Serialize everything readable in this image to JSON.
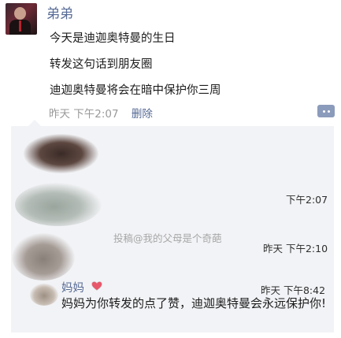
{
  "post": {
    "author": "弟弟",
    "lines": [
      "今天是迪迦奥特曼的生日",
      "转发这句话到朋友圈",
      "迪迦奥特曼将会在暗中保护你三周"
    ],
    "time": "昨天 下午2:07",
    "delete_label": "删除"
  },
  "comments": {
    "times": [
      "下午2:07",
      "昨天 下午2:10",
      "昨天 下午8:42"
    ],
    "watermark": "投稿@我的父母是个奇葩",
    "mom": {
      "name": "妈妈",
      "message": "妈妈为你转发的点了赞，迪迦奥特曼会永远保护你!"
    }
  },
  "colors": {
    "link": "#576b95",
    "panel": "#f2f3f6",
    "heart": "#e8566a"
  },
  "icons": {
    "comment_button": "comment-dots-icon",
    "mom_badge": "heart-icon"
  }
}
